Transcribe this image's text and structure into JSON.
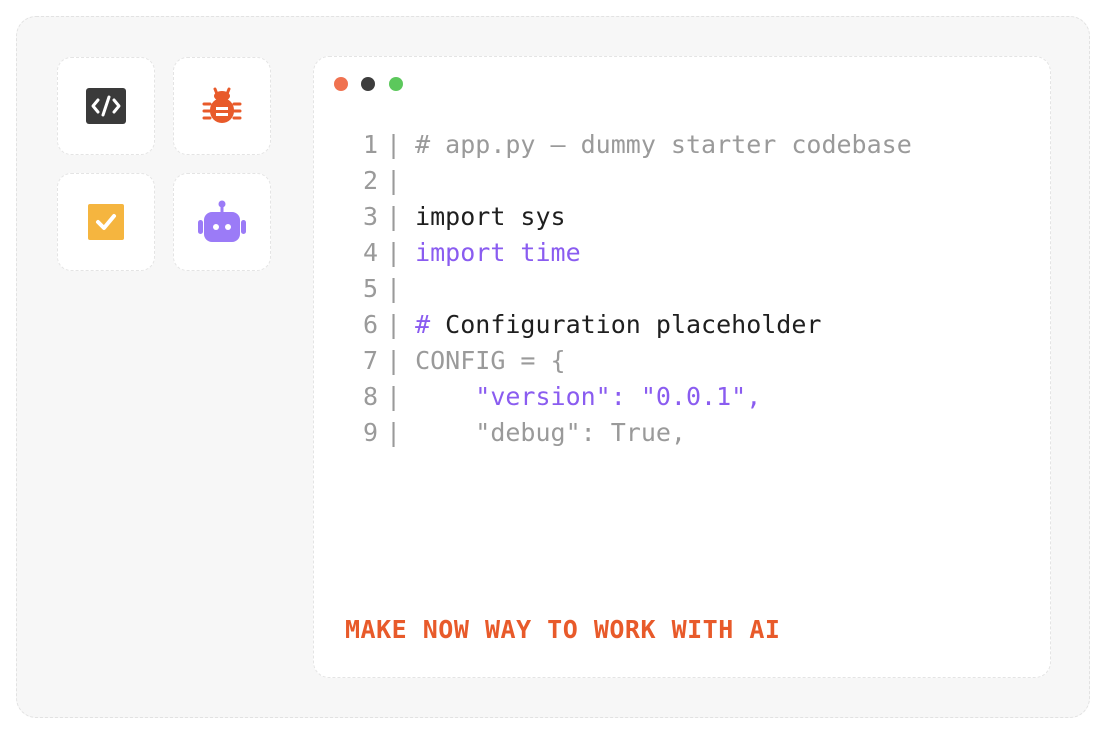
{
  "tools": [
    {
      "name": "code",
      "icon": "code-icon",
      "color": "#3a3a3a"
    },
    {
      "name": "bug",
      "icon": "bug-icon",
      "color": "#e85a2a"
    },
    {
      "name": "task",
      "icon": "checkbox-icon",
      "color": "#f5b53f"
    },
    {
      "name": "robot",
      "icon": "robot-icon",
      "color": "#9b7bf7"
    }
  ],
  "window_controls": {
    "colors": [
      "#f07250",
      "#3d3d3d",
      "#5cc85c"
    ]
  },
  "code_lines": [
    {
      "num": "1",
      "sep": "|",
      "tokens": [
        {
          "text": "# app.py — dummy starter codebase",
          "style": "gray"
        }
      ]
    },
    {
      "num": "2",
      "sep": "|",
      "tokens": []
    },
    {
      "num": "3",
      "sep": "|",
      "tokens": [
        {
          "text": "import sys",
          "style": "dark"
        }
      ]
    },
    {
      "num": "4",
      "sep": "|",
      "tokens": [
        {
          "text": "import time",
          "style": "purple"
        }
      ]
    },
    {
      "num": "5",
      "sep": "|",
      "tokens": []
    },
    {
      "num": "6",
      "sep": "|",
      "tokens": [
        {
          "text": "# ",
          "style": "purple"
        },
        {
          "text": "Configuration placeholder",
          "style": "dark"
        }
      ]
    },
    {
      "num": "7",
      "sep": "|",
      "tokens": [
        {
          "text": "CONFIG = {",
          "style": "gray"
        }
      ]
    },
    {
      "num": "8",
      "sep": "|",
      "tokens": [
        {
          "text": "    \"version\": \"0.0.1\",",
          "style": "purple"
        }
      ]
    },
    {
      "num": "9",
      "sep": "|",
      "tokens": [
        {
          "text": "    \"debug\": True,",
          "style": "gray"
        }
      ]
    }
  ],
  "tagline": "MAKE NOW WAY TO WORK WITH AI"
}
